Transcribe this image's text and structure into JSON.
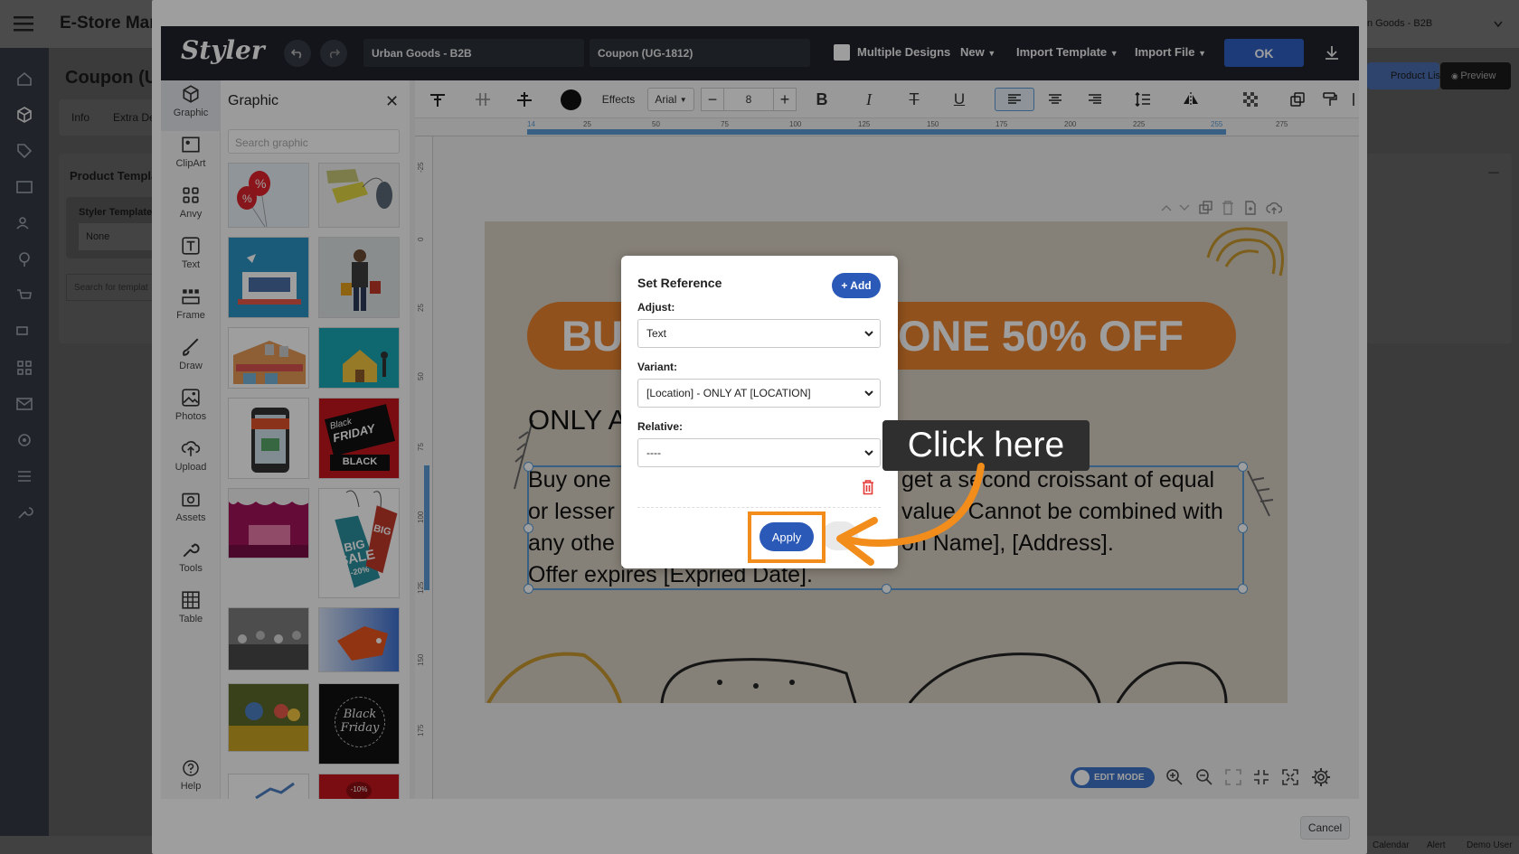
{
  "background_app": {
    "app_title": "E-Store Mar",
    "page_title": "Coupon (U",
    "tabs": [
      "Info",
      "Extra De"
    ],
    "section_title": "Product Templa",
    "field_label": "Styler Template",
    "field_value": "None",
    "search_placeholder": "Search for templat",
    "store_select": "n Goods - B2B",
    "product_list_label": "Product List",
    "preview_label": "Preview",
    "footer_items": [
      "Calendar",
      "Alert",
      "Demo User"
    ],
    "collapse_symbol": "—"
  },
  "styler": {
    "logo": "Styler",
    "store_field": "Urban Goods - B2B",
    "coupon_field": "Coupon (UG-1812)",
    "multiple_designs_label": "Multiple Designs",
    "menus": [
      "New",
      "Import Template",
      "Import File"
    ],
    "ok_label": "OK",
    "cancel_label": "Cancel"
  },
  "tools": [
    {
      "label": "Graphic",
      "icon": "cube-icon"
    },
    {
      "label": "ClipArt",
      "icon": "clipart-icon"
    },
    {
      "label": "Anvy",
      "icon": "grid-icon"
    },
    {
      "label": "Text",
      "icon": "text-icon"
    },
    {
      "label": "Frame",
      "icon": "frame-icon"
    },
    {
      "label": "Draw",
      "icon": "brush-icon"
    },
    {
      "label": "Photos",
      "icon": "photo-icon"
    },
    {
      "label": "Upload",
      "icon": "upload-icon"
    },
    {
      "label": "Assets",
      "icon": "camera-icon"
    },
    {
      "label": "Tools",
      "icon": "wrench-icon"
    },
    {
      "label": "Table",
      "icon": "table-icon"
    },
    {
      "label": "Help",
      "icon": "help-icon"
    }
  ],
  "graphic_panel": {
    "title": "Graphic",
    "search_placeholder": "Search graphic",
    "thumb_text": {
      "black_friday_1": "Black",
      "black_friday_2": "FRIDAY",
      "black_friday_3": "BLACK",
      "big_sale_1": "BIG",
      "big_sale_2": "SALE",
      "big_sale_3": "-20%",
      "black_friday_round_1": "Black",
      "black_friday_round_2": "Friday",
      "minus10": "-10%"
    }
  },
  "toolbar": {
    "effects_label": "Effects",
    "font_family": "Arial",
    "font_size": "8",
    "current_color": "#111111"
  },
  "ruler": {
    "h_ticks": [
      "14",
      "25",
      "50",
      "75",
      "100",
      "125",
      "150",
      "175",
      "200",
      "225",
      "255",
      "275"
    ],
    "v_ticks": [
      "-25",
      "0",
      "25",
      "50",
      "75",
      "100",
      "125",
      "150",
      "175"
    ]
  },
  "design": {
    "banner_left": "BU",
    "banner_right": "ONE 50% OFF",
    "only_at": "ONLY A",
    "body_lines": [
      {
        "left": "Buy one",
        "right": "get a second croissant of equal"
      },
      {
        "left": "or lesser",
        "right": "value. Cannot be combined with"
      },
      {
        "left": "any othe",
        "right": "on Name], [Address]."
      },
      {
        "left": "Offer expires [Expried Date].",
        "right": ""
      }
    ]
  },
  "set_reference": {
    "title": "Set Reference",
    "add_label": "+ Add",
    "adjust_label": "Adjust:",
    "adjust_value": "Text",
    "variant_label": "Variant:",
    "variant_value": "[Location] - ONLY AT [LOCATION]",
    "relative_label": "Relative:",
    "relative_value": "----",
    "apply_label": "Apply"
  },
  "callout": {
    "text": "Click here"
  },
  "canvas_controls": {
    "edit_mode_label": "EDIT MODE"
  },
  "colors": {
    "accent": "#2b59b7",
    "highlight": "#f28c1a",
    "banner": "#e8832f",
    "header": "#1f232b",
    "selection": "#5b9bd5"
  }
}
